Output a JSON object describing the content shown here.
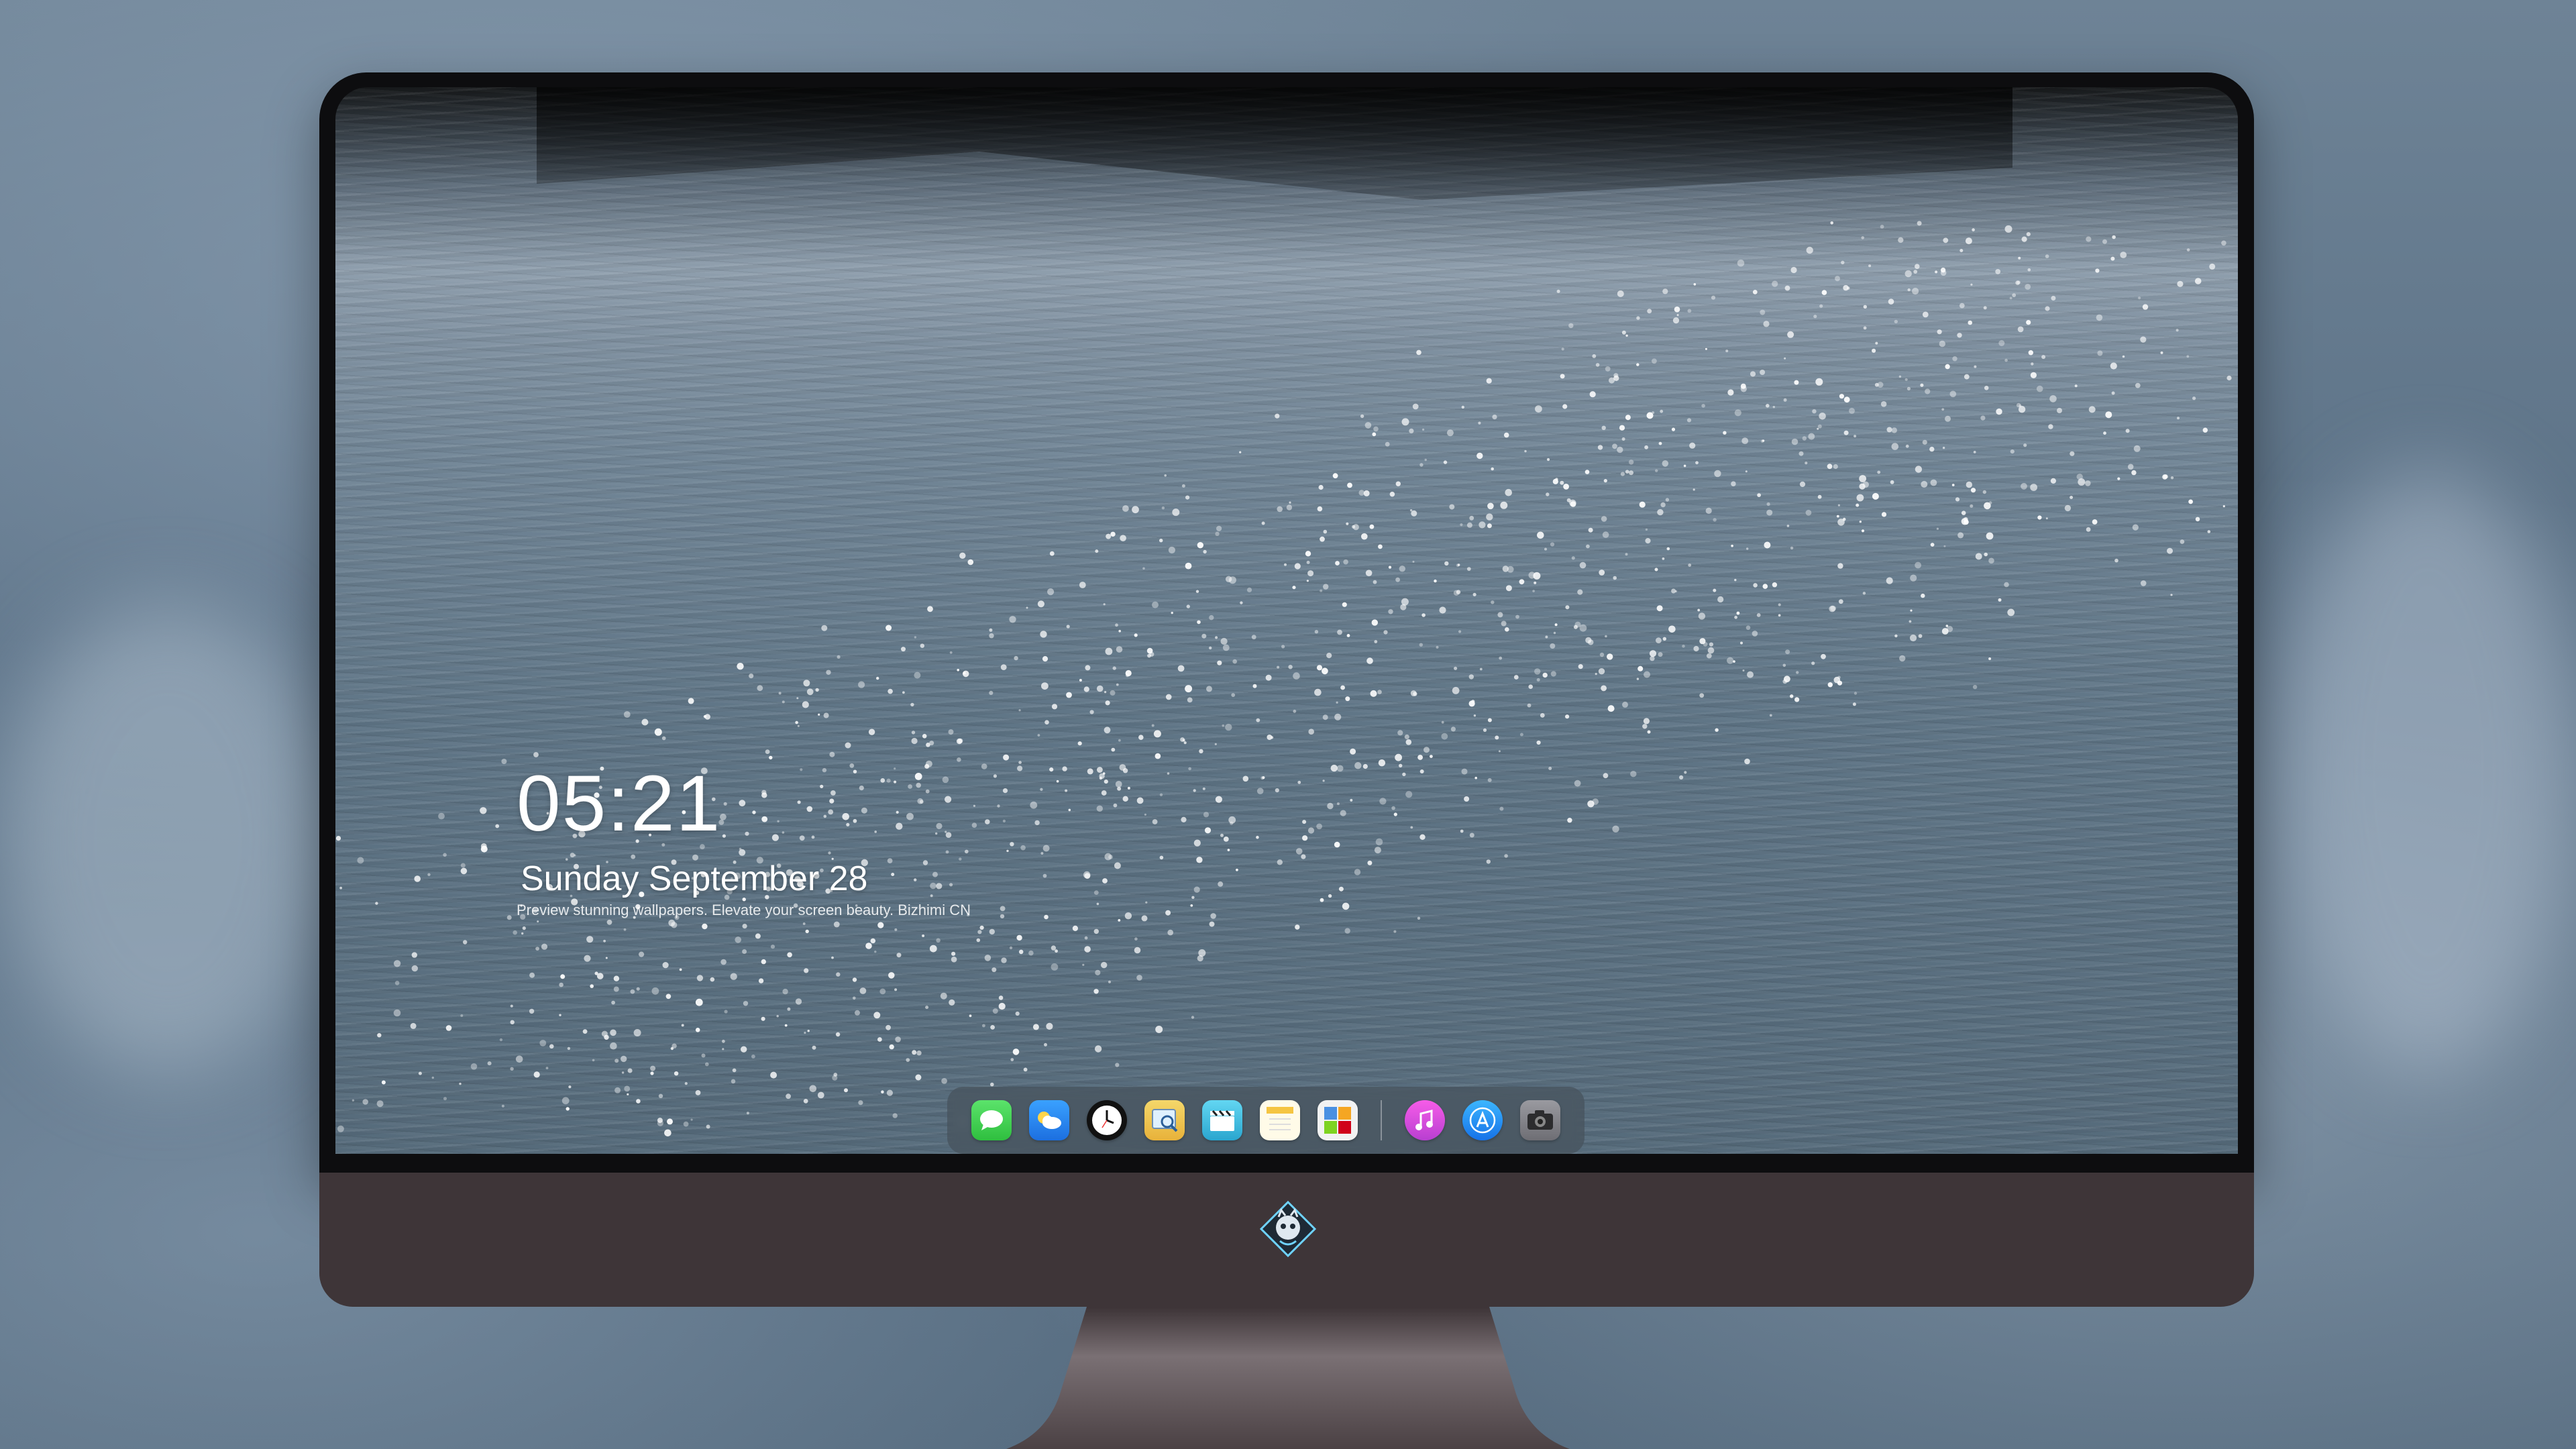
{
  "lock_screen": {
    "time": "05:21",
    "date": "Sunday September 28",
    "tagline": "Preview stunning wallpapers. Elevate your screen beauty. Bizhimi CN"
  },
  "dock": {
    "apps": [
      {
        "name": "messages",
        "icon": "message-bubble-icon",
        "color": "#34c759"
      },
      {
        "name": "weather",
        "icon": "cloud-sun-icon",
        "color": "#2f8ff0"
      },
      {
        "name": "clock",
        "icon": "clock-icon",
        "color": "#111111"
      },
      {
        "name": "preview",
        "icon": "magnifier-photo-icon",
        "color": "#f2c94c"
      },
      {
        "name": "clips",
        "icon": "clapperboard-icon",
        "color": "#45c2e6"
      },
      {
        "name": "notes",
        "icon": "notepad-icon",
        "color": "#fff7d6"
      },
      {
        "name": "photo-booth",
        "icon": "photo-grid-icon",
        "color": "#e8e8e8"
      },
      {
        "name": "itunes",
        "icon": "music-note-icon",
        "color": "#e84dd8"
      },
      {
        "name": "app-store",
        "icon": "app-store-icon",
        "color": "#1a9cff"
      },
      {
        "name": "camera",
        "icon": "camera-icon",
        "color": "#8e8e93"
      }
    ]
  },
  "colors": {
    "bezel": "#0d0d0f",
    "chin": "#3e3538",
    "stand": "#6b6165"
  }
}
